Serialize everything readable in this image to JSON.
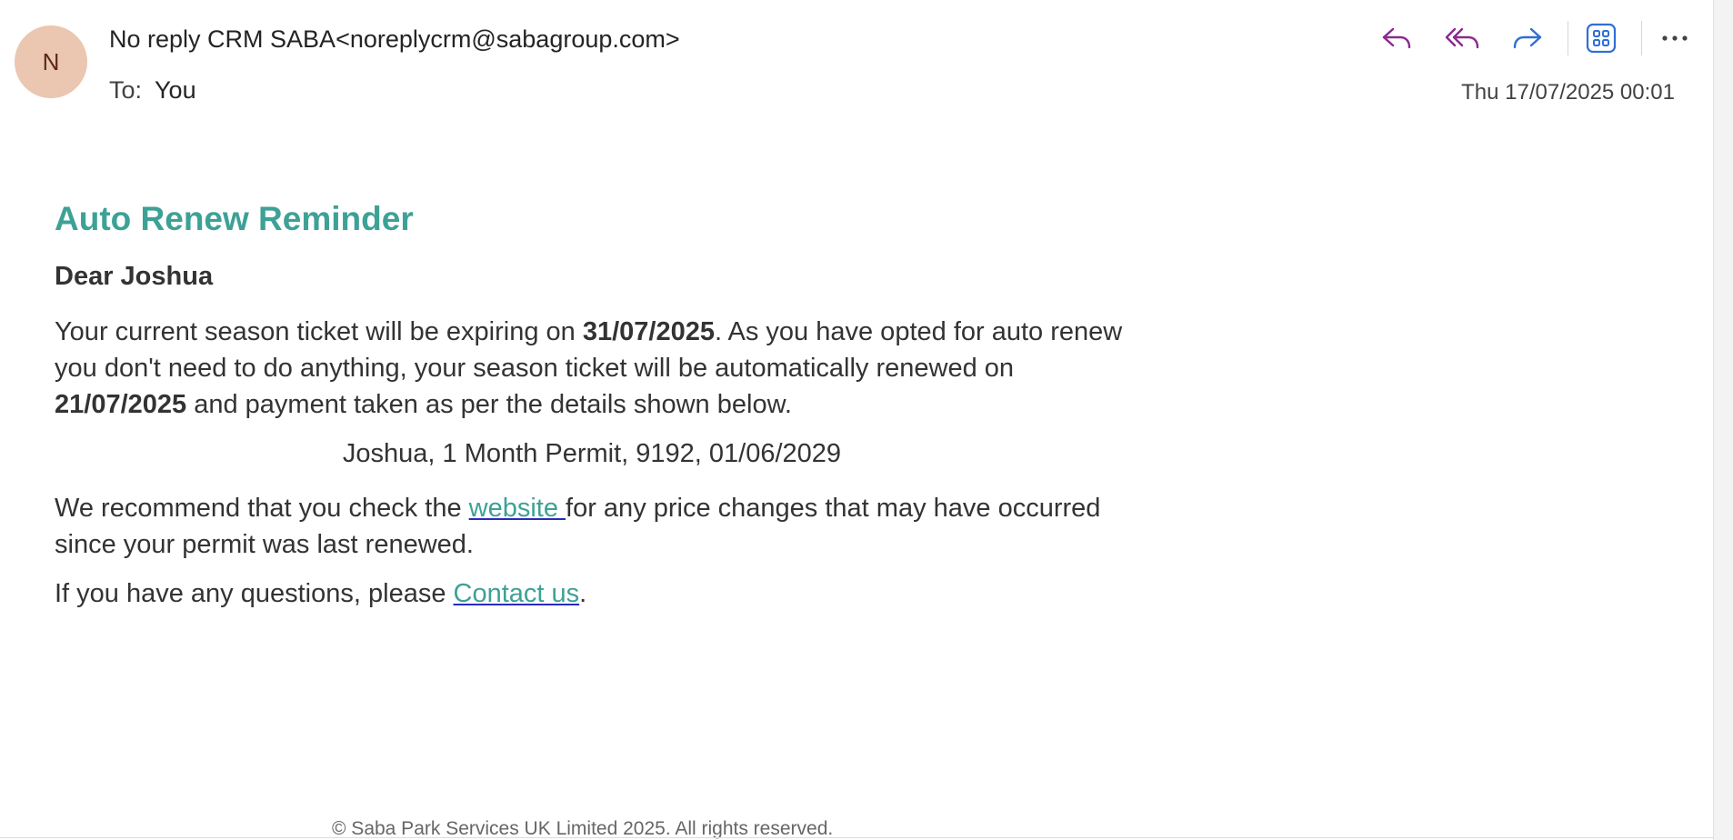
{
  "header": {
    "avatar_initial": "N",
    "sender": "No reply CRM SABA<noreplycrm@sabagroup.com>",
    "to_label": "To:",
    "to_value": "You",
    "timestamp": "Thu 17/07/2025 00:01"
  },
  "toolbar": {
    "reply_icon": "reply-icon",
    "reply_all_icon": "reply-all-icon",
    "forward_icon": "forward-icon",
    "apps_icon": "apps-icon",
    "more_icon": "more-icon",
    "colors": {
      "reply": "#8a2a8e",
      "forward": "#2f6fd6",
      "apps": "#2f6fd6",
      "more": "#424242"
    }
  },
  "message": {
    "title": "Auto Renew Reminder",
    "greeting": "Dear Joshua",
    "p1_a": "Your current season ticket will be expiring on ",
    "expiry_date": "31/07/2025",
    "p1_b": ". As you have opted for auto renew you don't need to do anything, your season ticket will be automatically renewed on ",
    "renew_date": "21/07/2025",
    "p1_c": " and payment taken as per the details shown below.",
    "details": "Joshua, 1 Month Permit, 9192, 01/06/2029",
    "p2_a": "We recommend that you check the ",
    "website_link": "website ",
    "p2_b": "for any price changes that may have occurred since your permit was last renewed.",
    "p3_a": "If you have any questions, please ",
    "contact_link": "Contact us",
    "p3_b": ".",
    "footer": "© Saba Park Services UK Limited 2025. All rights reserved."
  },
  "colors": {
    "accent": "#3da196",
    "avatar_bg": "#ebc6b1",
    "text": "#333333"
  }
}
